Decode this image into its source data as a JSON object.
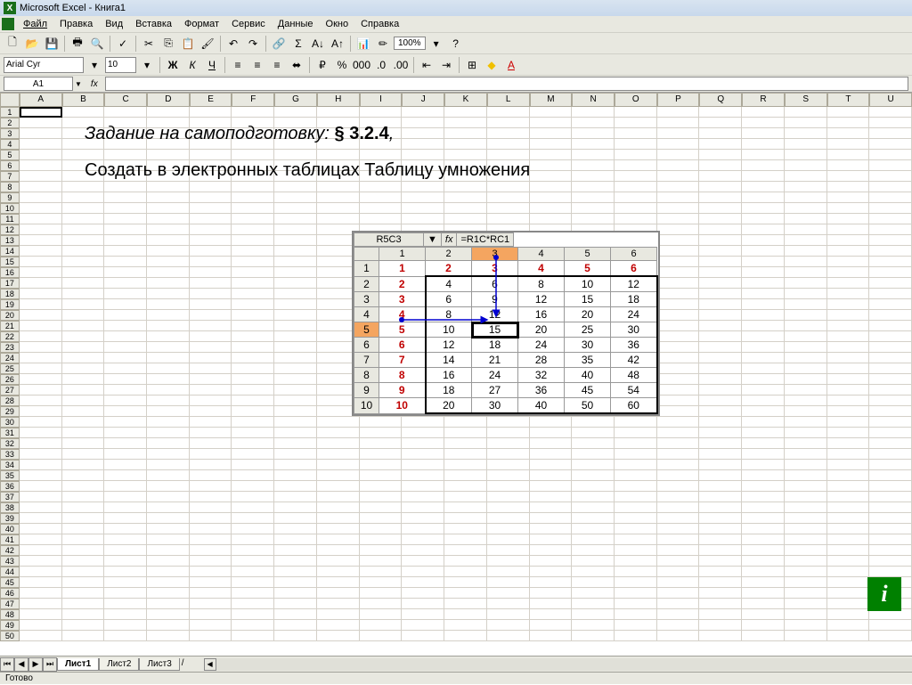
{
  "window": {
    "title": "Microsoft Excel - Книга1"
  },
  "menu": [
    "Файл",
    "Правка",
    "Вид",
    "Вставка",
    "Формат",
    "Сервис",
    "Данные",
    "Окно",
    "Справка"
  ],
  "toolbar": {
    "zoom": "100%"
  },
  "format": {
    "font": "Arial Cyr",
    "size": "10"
  },
  "formula_bar": {
    "name": "A1",
    "fx_label": "fx",
    "formula": ""
  },
  "columns": [
    "A",
    "B",
    "C",
    "D",
    "E",
    "F",
    "G",
    "H",
    "I",
    "J",
    "K",
    "L",
    "M",
    "N",
    "O",
    "P",
    "Q",
    "R",
    "S",
    "T",
    "U"
  ],
  "row_count": 50,
  "overlay": {
    "line1_italic": "Задание на самоподготовку:",
    "line1_bold": " § 3.2.4",
    "line1_tail": ",",
    "line2": "Создать в электронных таблицах Таблицу умножения"
  },
  "embed": {
    "namebox": "R5C3",
    "dropdown": "▼",
    "fx": "fx",
    "formula": "=R1C*RC1",
    "col_hdrs": [
      "",
      "1",
      "2",
      "3",
      "4",
      "5",
      "6"
    ],
    "sel_col_idx": 3,
    "sel_row_idx": 5,
    "rows": [
      {
        "h": "1",
        "cells": [
          "1",
          "2",
          "3",
          "4",
          "5",
          "6"
        ],
        "red_all": true
      },
      {
        "h": "2",
        "cells": [
          "2",
          "4",
          "6",
          "8",
          "10",
          "12"
        ]
      },
      {
        "h": "3",
        "cells": [
          "3",
          "6",
          "9",
          "12",
          "15",
          "18"
        ]
      },
      {
        "h": "4",
        "cells": [
          "4",
          "8",
          "12",
          "16",
          "20",
          "24"
        ]
      },
      {
        "h": "5",
        "cells": [
          "5",
          "10",
          "15",
          "20",
          "25",
          "30"
        ]
      },
      {
        "h": "6",
        "cells": [
          "6",
          "12",
          "18",
          "24",
          "30",
          "36"
        ]
      },
      {
        "h": "7",
        "cells": [
          "7",
          "14",
          "21",
          "28",
          "35",
          "42"
        ]
      },
      {
        "h": "8",
        "cells": [
          "8",
          "16",
          "24",
          "32",
          "40",
          "48"
        ]
      },
      {
        "h": "9",
        "cells": [
          "9",
          "18",
          "27",
          "36",
          "45",
          "54"
        ]
      },
      {
        "h": "10",
        "cells": [
          "10",
          "20",
          "30",
          "40",
          "50",
          "60"
        ]
      }
    ]
  },
  "tabs": {
    "items": [
      "Лист1",
      "Лист2",
      "Лист3"
    ],
    "active": 0
  },
  "status": "Готово"
}
